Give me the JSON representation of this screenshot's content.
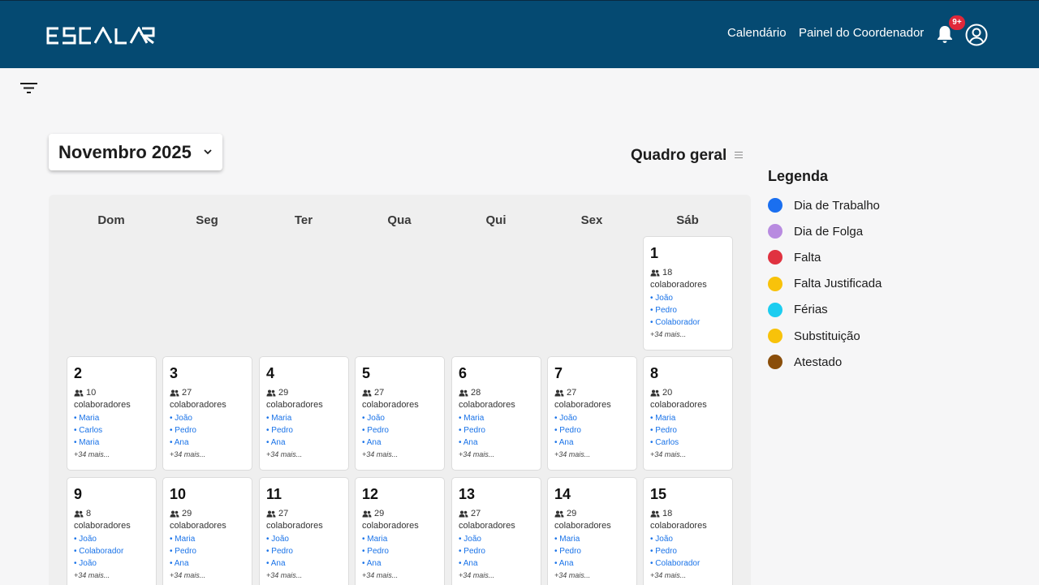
{
  "header": {
    "logo_text": "ESCALAR",
    "nav": [
      {
        "label": "Calendário"
      },
      {
        "label": "Painel do Coordenador"
      }
    ],
    "notification_badge": "9+",
    "icons": [
      "bell-icon",
      "user-circle-icon",
      "filter-icon"
    ]
  },
  "calendar": {
    "month_label": "Novembro 2025",
    "view_label": "Quadro geral",
    "weekdays": [
      "Dom",
      "Seg",
      "Ter",
      "Qua",
      "Qui",
      "Sex",
      "Sáb"
    ],
    "colab_label": "colaboradores",
    "days": [
      {
        "num": "1",
        "count": "18",
        "names": [
          "João",
          "Pedro",
          "Colaborador"
        ],
        "more": "+34 mais..."
      },
      {
        "num": "2",
        "count": "10",
        "names": [
          "Maria",
          "Carlos",
          "Maria"
        ],
        "more": "+34 mais..."
      },
      {
        "num": "3",
        "count": "27",
        "names": [
          "João",
          "Pedro",
          "Ana"
        ],
        "more": "+34 mais..."
      },
      {
        "num": "4",
        "count": "29",
        "names": [
          "Maria",
          "Pedro",
          "Ana"
        ],
        "more": "+34 mais..."
      },
      {
        "num": "5",
        "count": "27",
        "names": [
          "João",
          "Pedro",
          "Ana"
        ],
        "more": "+34 mais..."
      },
      {
        "num": "6",
        "count": "28",
        "names": [
          "Maria",
          "Pedro",
          "Ana"
        ],
        "more": "+34 mais..."
      },
      {
        "num": "7",
        "count": "27",
        "names": [
          "João",
          "Pedro",
          "Ana"
        ],
        "more": "+34 mais..."
      },
      {
        "num": "8",
        "count": "20",
        "names": [
          "Maria",
          "Pedro",
          "Carlos"
        ],
        "more": "+34 mais..."
      },
      {
        "num": "9",
        "count": "8",
        "names": [
          "João",
          "Colaborador",
          "João"
        ],
        "more": "+34 mais..."
      },
      {
        "num": "10",
        "count": "29",
        "names": [
          "Maria",
          "Pedro",
          "Ana"
        ],
        "more": "+34 mais..."
      },
      {
        "num": "11",
        "count": "27",
        "names": [
          "João",
          "Pedro",
          "Ana"
        ],
        "more": "+34 mais..."
      },
      {
        "num": "12",
        "count": "29",
        "names": [
          "Maria",
          "Pedro",
          "Ana"
        ],
        "more": "+34 mais..."
      },
      {
        "num": "13",
        "count": "27",
        "names": [
          "João",
          "Pedro",
          "Ana"
        ],
        "more": "+34 mais..."
      },
      {
        "num": "14",
        "count": "29",
        "names": [
          "Maria",
          "Pedro",
          "Ana"
        ],
        "more": "+34 mais..."
      },
      {
        "num": "15",
        "count": "18",
        "names": [
          "João",
          "Pedro",
          "Colaborador"
        ],
        "more": "+34 mais..."
      }
    ]
  },
  "legend": {
    "title": "Legenda",
    "items": [
      {
        "label": "Dia de Trabalho",
        "color": "#1a6ff0"
      },
      {
        "label": "Dia de Folga",
        "color": "#b88be0"
      },
      {
        "label": "Falta",
        "color": "#e03240"
      },
      {
        "label": "Falta Justificada",
        "color": "#f8c20a"
      },
      {
        "label": "Férias",
        "color": "#1ccdf0"
      },
      {
        "label": "Substituição",
        "color": "#f8c20a"
      },
      {
        "label": "Atestado",
        "color": "#8a4e0a"
      }
    ]
  },
  "colors": {
    "header_bg": "#054a72",
    "accent_blue": "#1a73e8",
    "badge_red": "#e0283a"
  }
}
